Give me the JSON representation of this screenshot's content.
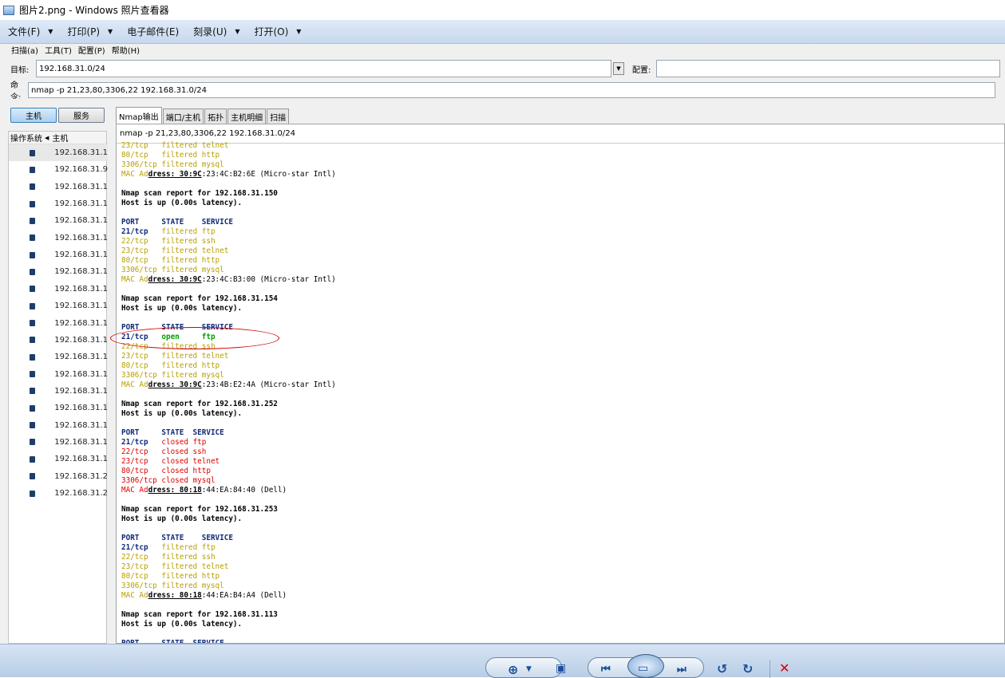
{
  "window": {
    "title": "图片2.png - Windows 照片查看器"
  },
  "viewer_menu": [
    "文件(F)",
    "打印(P)",
    "电子邮件(E)",
    "刻录(U)",
    "打开(O)"
  ],
  "nmap_menu": [
    "扫描(a)",
    "工具(T)",
    "配置(P)",
    "帮助(H)"
  ],
  "target": {
    "label": "目标:",
    "value": "192.168.31.0/24",
    "profile_label": "配置:",
    "profile_value": ""
  },
  "command": {
    "label": "命令:",
    "value": "nmap -p 21,23,80,3306,22 192.168.31.0/24"
  },
  "side_buttons": {
    "hosts": "主机",
    "services": "服务"
  },
  "hostlist": {
    "col_os": "操作系统",
    "col_host": "主机",
    "hosts": [
      "192.168.31.1",
      "192.168.31.9",
      "192.168.31.1",
      "192.168.31.1",
      "192.168.31.1",
      "192.168.31.1",
      "192.168.31.1",
      "192.168.31.1",
      "192.168.31.1",
      "192.168.31.1",
      "192.168.31.1",
      "192.168.31.1",
      "192.168.31.1",
      "192.168.31.1",
      "192.168.31.1",
      "192.168.31.1",
      "192.168.31.1",
      "192.168.31.1",
      "192.168.31.1",
      "192.168.31.2",
      "192.168.31.2"
    ]
  },
  "tabs": [
    "Nmap输出",
    "端口/主机",
    "拓扑",
    "主机明细",
    "扫描"
  ],
  "output_cmd": "nmap -p 21,23,80,3306,22 192.168.31.0/24",
  "output_lines": [
    [
      [
        "23/tcp   filtered telnet",
        "y"
      ]
    ],
    [
      [
        "80/tcp   filtered http",
        "y"
      ]
    ],
    [
      [
        "3306/tcp filtered mysql",
        "y"
      ]
    ],
    [
      [
        "MAC Ad",
        "y"
      ],
      [
        "dress: 30:9C",
        "u"
      ],
      [
        ":23:4C:B2:6E (Micro-star Intl)",
        ""
      ]
    ],
    [
      [
        "",
        ""
      ]
    ],
    [
      [
        "Nmap scan report for 192.168.31.150",
        "k"
      ]
    ],
    [
      [
        "Host is up (0.00s latency).",
        "k"
      ]
    ],
    [
      [
        "",
        ""
      ]
    ],
    [
      [
        "PORT     STATE    SERVICE",
        "b"
      ]
    ],
    [
      [
        "21/tcp",
        "b"
      ],
      [
        "   filtered ftp",
        "y"
      ]
    ],
    [
      [
        "22/tcp   filtered ssh",
        "y"
      ]
    ],
    [
      [
        "23/tcp   filtered telnet",
        "y"
      ]
    ],
    [
      [
        "80/tcp   filtered http",
        "y"
      ]
    ],
    [
      [
        "3306/tcp filtered mysql",
        "y"
      ]
    ],
    [
      [
        "MAC Ad",
        "y"
      ],
      [
        "dress: 30:9C",
        "u"
      ],
      [
        ":23:4C:B3:00 (Micro-star Intl)",
        ""
      ]
    ],
    [
      [
        "",
        ""
      ]
    ],
    [
      [
        "Nmap scan report for 192.168.31.154",
        "k"
      ]
    ],
    [
      [
        "Host is up (0.00s latency).",
        "k"
      ]
    ],
    [
      [
        "",
        ""
      ]
    ],
    [
      [
        "PORT     STATE    SERVICE",
        "b"
      ]
    ],
    [
      [
        "21/tcp",
        "b"
      ],
      [
        "   open     ftp",
        "g"
      ]
    ],
    [
      [
        "22/tcp   filtered ssh",
        "y"
      ]
    ],
    [
      [
        "23/tcp   filtered telnet",
        "y"
      ]
    ],
    [
      [
        "80/tcp   filtered http",
        "y"
      ]
    ],
    [
      [
        "3306/tcp filtered mysql",
        "y"
      ]
    ],
    [
      [
        "MAC Ad",
        "y"
      ],
      [
        "dress: 30:9C",
        "u"
      ],
      [
        ":23:4B:E2:4A (Micro-star Intl)",
        ""
      ]
    ],
    [
      [
        "",
        ""
      ]
    ],
    [
      [
        "Nmap scan report for 192.168.31.252",
        "k"
      ]
    ],
    [
      [
        "Host is up (0.00s latency).",
        "k"
      ]
    ],
    [
      [
        "",
        ""
      ]
    ],
    [
      [
        "PORT     STATE  SERVICE",
        "b"
      ]
    ],
    [
      [
        "21/tcp",
        "b"
      ],
      [
        "   closed ftp",
        "r"
      ]
    ],
    [
      [
        "22/tcp   closed ssh",
        "r"
      ]
    ],
    [
      [
        "23/tcp   closed telnet",
        "r"
      ]
    ],
    [
      [
        "80/tcp   closed http",
        "r"
      ]
    ],
    [
      [
        "3306/tcp closed mysql",
        "r"
      ]
    ],
    [
      [
        "MAC Ad",
        "r"
      ],
      [
        "dress: 80:18",
        "u"
      ],
      [
        ":44:EA:84:40 (Dell)",
        ""
      ]
    ],
    [
      [
        "",
        ""
      ]
    ],
    [
      [
        "Nmap scan report for 192.168.31.253",
        "k"
      ]
    ],
    [
      [
        "Host is up (0.00s latency).",
        "k"
      ]
    ],
    [
      [
        "",
        ""
      ]
    ],
    [
      [
        "PORT     STATE    SERVICE",
        "b"
      ]
    ],
    [
      [
        "21/tcp",
        "b"
      ],
      [
        "   filtered ftp",
        "y"
      ]
    ],
    [
      [
        "22/tcp   filtered ssh",
        "y"
      ]
    ],
    [
      [
        "23/tcp   filtered telnet",
        "y"
      ]
    ],
    [
      [
        "80/tcp   filtered http",
        "y"
      ]
    ],
    [
      [
        "3306/tcp filtered mysql",
        "y"
      ]
    ],
    [
      [
        "MAC Ad",
        "y"
      ],
      [
        "dress: 80:18",
        "u"
      ],
      [
        ":44:EA:B4:A4 (Dell)",
        ""
      ]
    ],
    [
      [
        "",
        ""
      ]
    ],
    [
      [
        "Nmap scan report for 192.168.31.113",
        "k"
      ]
    ],
    [
      [
        "Host is up (0.00s latency).",
        "k"
      ]
    ],
    [
      [
        "",
        ""
      ]
    ],
    [
      [
        "PORT     STATE  SERVICE",
        "b"
      ]
    ]
  ],
  "viewer_controls": [
    "zoom-icon",
    "fit-icon",
    "previous-icon",
    "slideshow-icon",
    "next-icon",
    "rotate-left-icon",
    "rotate-right-icon",
    "delete-icon"
  ]
}
